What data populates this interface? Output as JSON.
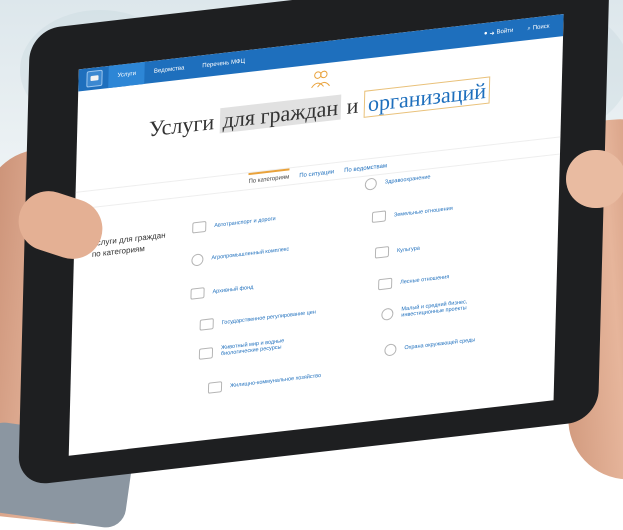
{
  "topbar": {
    "nav": [
      "Услуги",
      "Ведомства",
      "Перечень МФЦ"
    ],
    "login": "Войти",
    "search": "Поиск"
  },
  "hero": {
    "title_part1": "Услуги",
    "title_part2": "для граждан",
    "title_part3": "и",
    "title_part4": "организаций"
  },
  "tabs": [
    "По категориям",
    "По ситуации",
    "По ведомствам"
  ],
  "sidebar": {
    "label": "Услуги для граждан по категориям"
  },
  "categories_left": [
    "Автотранспорт и дороги",
    "Агропромышленный комплекс",
    "Архивный фонд",
    "Государственное регулирование цен",
    "Животный мир и водные биологические ресурсы",
    "Жилищно-коммунальное хозяйство"
  ],
  "categories_right": [
    "Здравоохранение",
    "Земельные отношения",
    "Культура",
    "Лесные отношения",
    "Малый и средний бизнес, инвестиционные проекты",
    "Охрана окружающей среды"
  ],
  "colors": {
    "brand_blue": "#1e6fbd",
    "accent_orange": "#e9a23b"
  }
}
